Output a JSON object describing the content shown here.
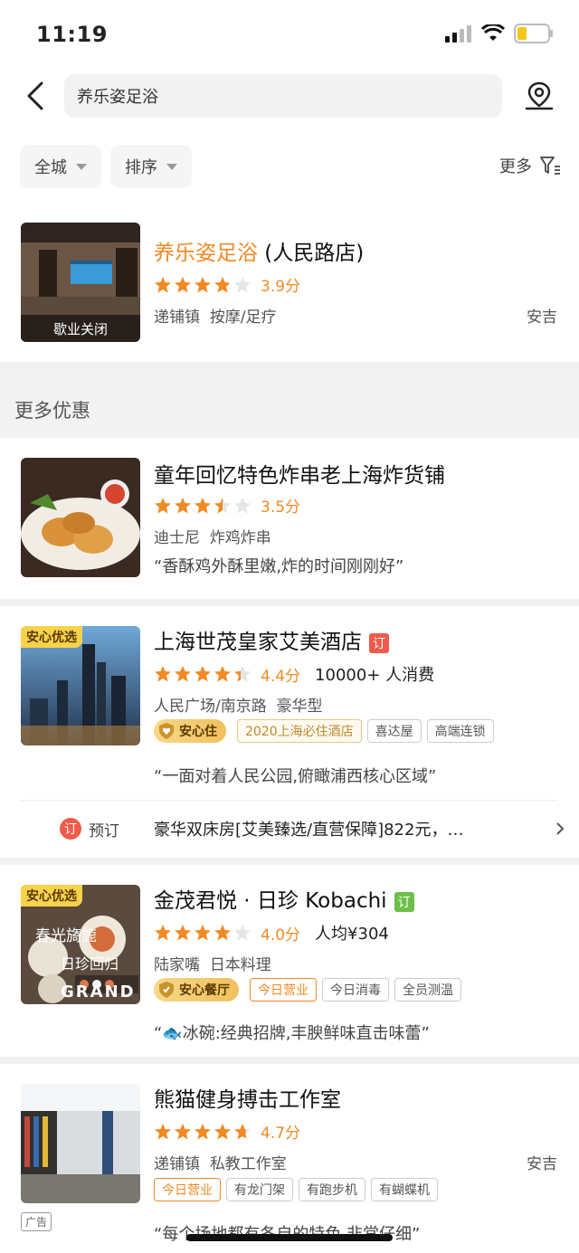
{
  "status": {
    "time": "11:19"
  },
  "search": {
    "value": "养乐姿足浴"
  },
  "filters": {
    "city": "全城",
    "sort": "排序",
    "more": "更多"
  },
  "main_result": {
    "title_highlight": "养乐姿足浴",
    "title_rest": " (人民路店)",
    "score": "3.9分",
    "rating": 3.9,
    "area": "递铺镇",
    "category": "按摩/足疗",
    "district": "安吉",
    "closed_label": "歇业关闭"
  },
  "section": {
    "more_deals": "更多优惠"
  },
  "items": [
    {
      "title": "童年回忆特色炸串老上海炸货铺",
      "score": "3.5分",
      "rating": 3.5,
      "area": "迪士尼",
      "category": "炸鸡炸串",
      "quote": "“香酥鸡外酥里嫩,炸的时间刚刚好”"
    },
    {
      "title": "上海世茂皇家艾美酒店",
      "ding": "订",
      "corner": "安心优选",
      "score": "4.4分",
      "rating": 4.4,
      "consumers": "10000+ 人消费",
      "area": "人民广场/南京路",
      "category": "豪华型",
      "badge": "安心住",
      "tags": [
        "2020上海必住酒店",
        "喜达屋",
        "高端连锁"
      ],
      "quote": "“一面对着人民公园,俯瞰浦西核心区域”",
      "book_label": "预订",
      "book_icon": "订",
      "book_text": "豪华双床房[艾美臻选/直营保障]822元，…"
    },
    {
      "title": "金茂君悦 · 日珍 Kobachi",
      "ding": "订",
      "corner": "安心优选",
      "photo_text_1": "春光旖旎",
      "photo_text_2": "日珍回归",
      "photo_text_3": "GRAND",
      "score": "4.0分",
      "rating": 4.0,
      "avg_price": "人均¥304",
      "area": "陆家嘴",
      "category": "日本料理",
      "badge": "安心餐厅",
      "tags": [
        "今日营业",
        "今日消毒",
        "全员测温"
      ],
      "quote": "“🐟冰碗:经典招牌,丰腴鲜味直击味蕾”"
    },
    {
      "title": "熊猫健身搏击工作室",
      "score": "4.7分",
      "rating": 4.7,
      "area": "递铺镇",
      "category": "私教工作室",
      "district": "安吉",
      "tags": [
        "今日营业",
        "有龙门架",
        "有跑步机",
        "有蝴蝶机"
      ],
      "ad_label": "广告",
      "quote": "“每个场地都有各自的特色,非常仔细”"
    }
  ],
  "colors": {
    "accent": "#f08a24",
    "star_empty": "#e5e5e5",
    "ding_red": "#f05a4a",
    "ding_green": "#6cc04a"
  }
}
